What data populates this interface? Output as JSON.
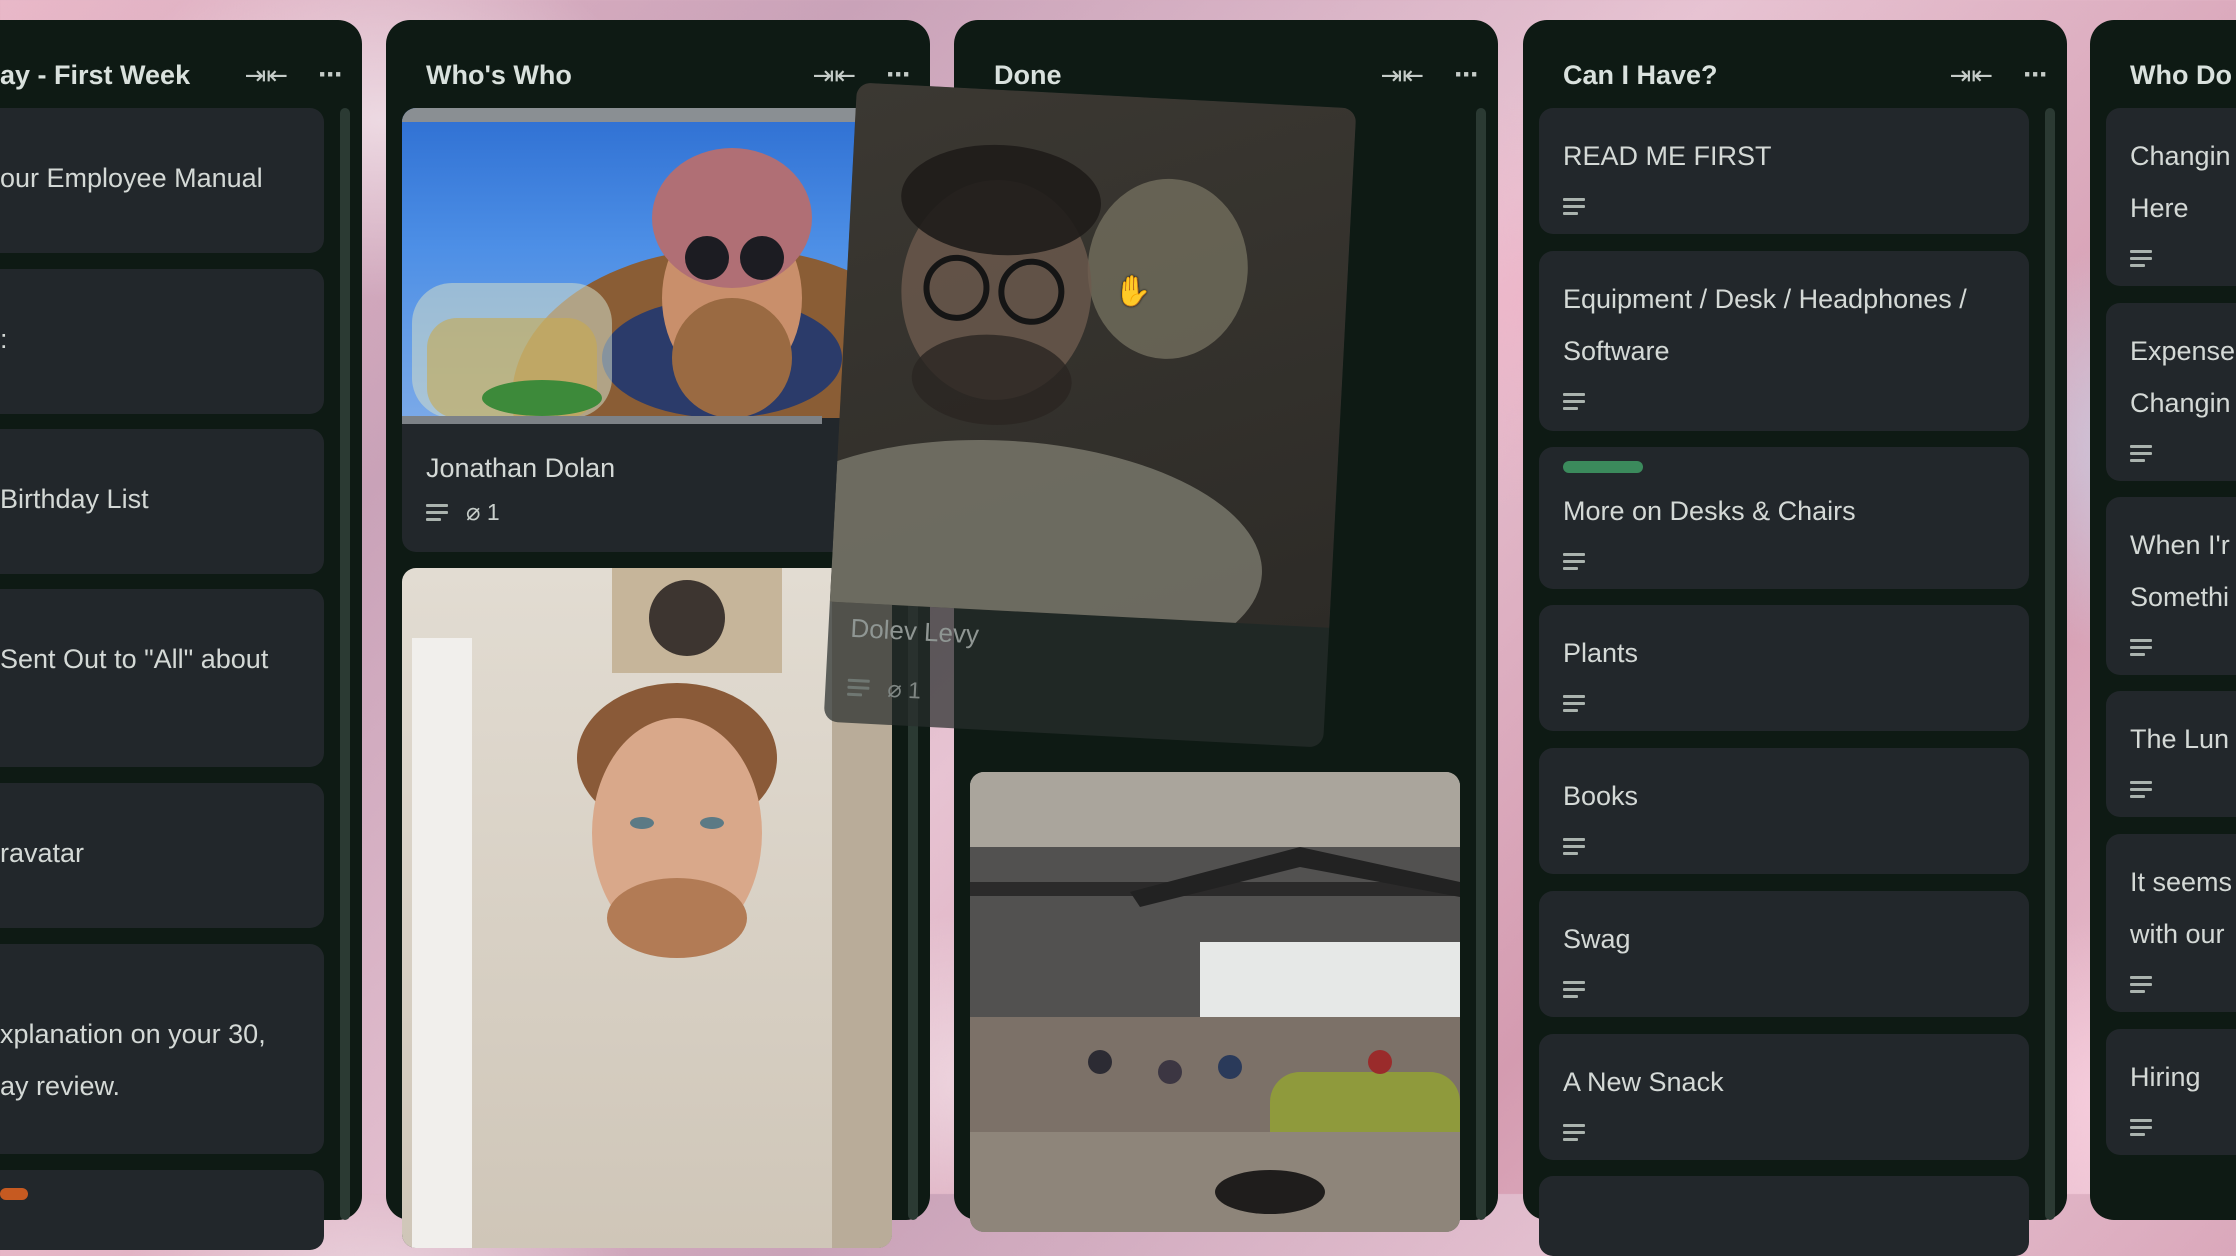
{
  "columns": [
    {
      "title": "ay - First Week",
      "cards": [
        {
          "title": "our Employee Manual"
        },
        {
          "title": ":"
        },
        {
          "title": " Birthday List"
        },
        {
          "title": " Sent Out to \"All\" about"
        },
        {
          "title": "ravatar"
        },
        {
          "title_line1": "xplanation on your 30,",
          "title_line2": "ay review."
        }
      ]
    },
    {
      "title": "Who's Who",
      "cards": [
        {
          "title": "Jonathan Dolan",
          "attachments": "1"
        }
      ]
    },
    {
      "title": "Done",
      "dragging_card": {
        "title": "Dolev Levy",
        "attachments": "1"
      }
    },
    {
      "title": "Can I Have?",
      "cards": [
        {
          "title": "READ ME FIRST"
        },
        {
          "title_line1": "Equipment / Desk / Headphones /",
          "title_line2": "Software"
        },
        {
          "title": "More on Desks & Chairs",
          "label_color": "#3b8a5c"
        },
        {
          "title": "Plants"
        },
        {
          "title": "Books"
        },
        {
          "title": "Swag"
        },
        {
          "title": "A New Snack"
        }
      ]
    },
    {
      "title": "Who Do",
      "cards": [
        {
          "title_line1": "Changin",
          "title_line2": "Here"
        },
        {
          "title_line1": "Expense",
          "title_line2": "Changin"
        },
        {
          "title_line1": "When I'r",
          "title_line2": "Somethi"
        },
        {
          "title": "The Lun"
        },
        {
          "title_line1": "It seems",
          "title_line2": "with our"
        },
        {
          "title": "Hiring"
        }
      ]
    }
  ],
  "icons": {
    "collapse": "arrows-inward-icon",
    "more": "ellipsis-icon",
    "description": "description-lines-icon",
    "attachment": "paperclip-icon",
    "cursor": "grab-hand-icon"
  },
  "colors": {
    "column_bg": "#0e1a14",
    "card_bg": "#22272b",
    "label_green": "#3b8a5c",
    "label_orange": "#c65a21"
  }
}
